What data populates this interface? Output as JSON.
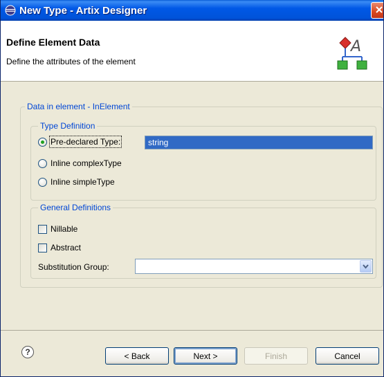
{
  "window": {
    "title": "New Type - Artix Designer",
    "title_icon": "eclipse-icon",
    "close_icon": "close-icon"
  },
  "header": {
    "title": "Define Element Data",
    "description": "Define the attributes of the element",
    "icon": "type-hierarchy-icon"
  },
  "main": {
    "outer_group_label": "Data in element - InElement",
    "type_definition": {
      "label": "Type Definition",
      "options": [
        {
          "label": "Pre-declared Type:",
          "checked": true
        },
        {
          "label": "Inline complexType",
          "checked": false
        },
        {
          "label": "Inline simpleType",
          "checked": false
        }
      ],
      "predeclared_value": "string"
    },
    "general_definitions": {
      "label": "General Definitions",
      "nillable_label": "Nillable",
      "nillable_checked": false,
      "abstract_label": "Abstract",
      "abstract_checked": false,
      "substitution_group_label": "Substitution Group:",
      "substitution_group_value": ""
    }
  },
  "footer": {
    "help_icon": "help-icon",
    "back_label": "< Back",
    "next_label": "Next >",
    "finish_label": "Finish",
    "cancel_label": "Cancel"
  },
  "colors": {
    "titlebar": "#0058e6",
    "group_label": "#0046d5",
    "selection": "#316ac5",
    "dialog_bg": "#ece9d8"
  }
}
